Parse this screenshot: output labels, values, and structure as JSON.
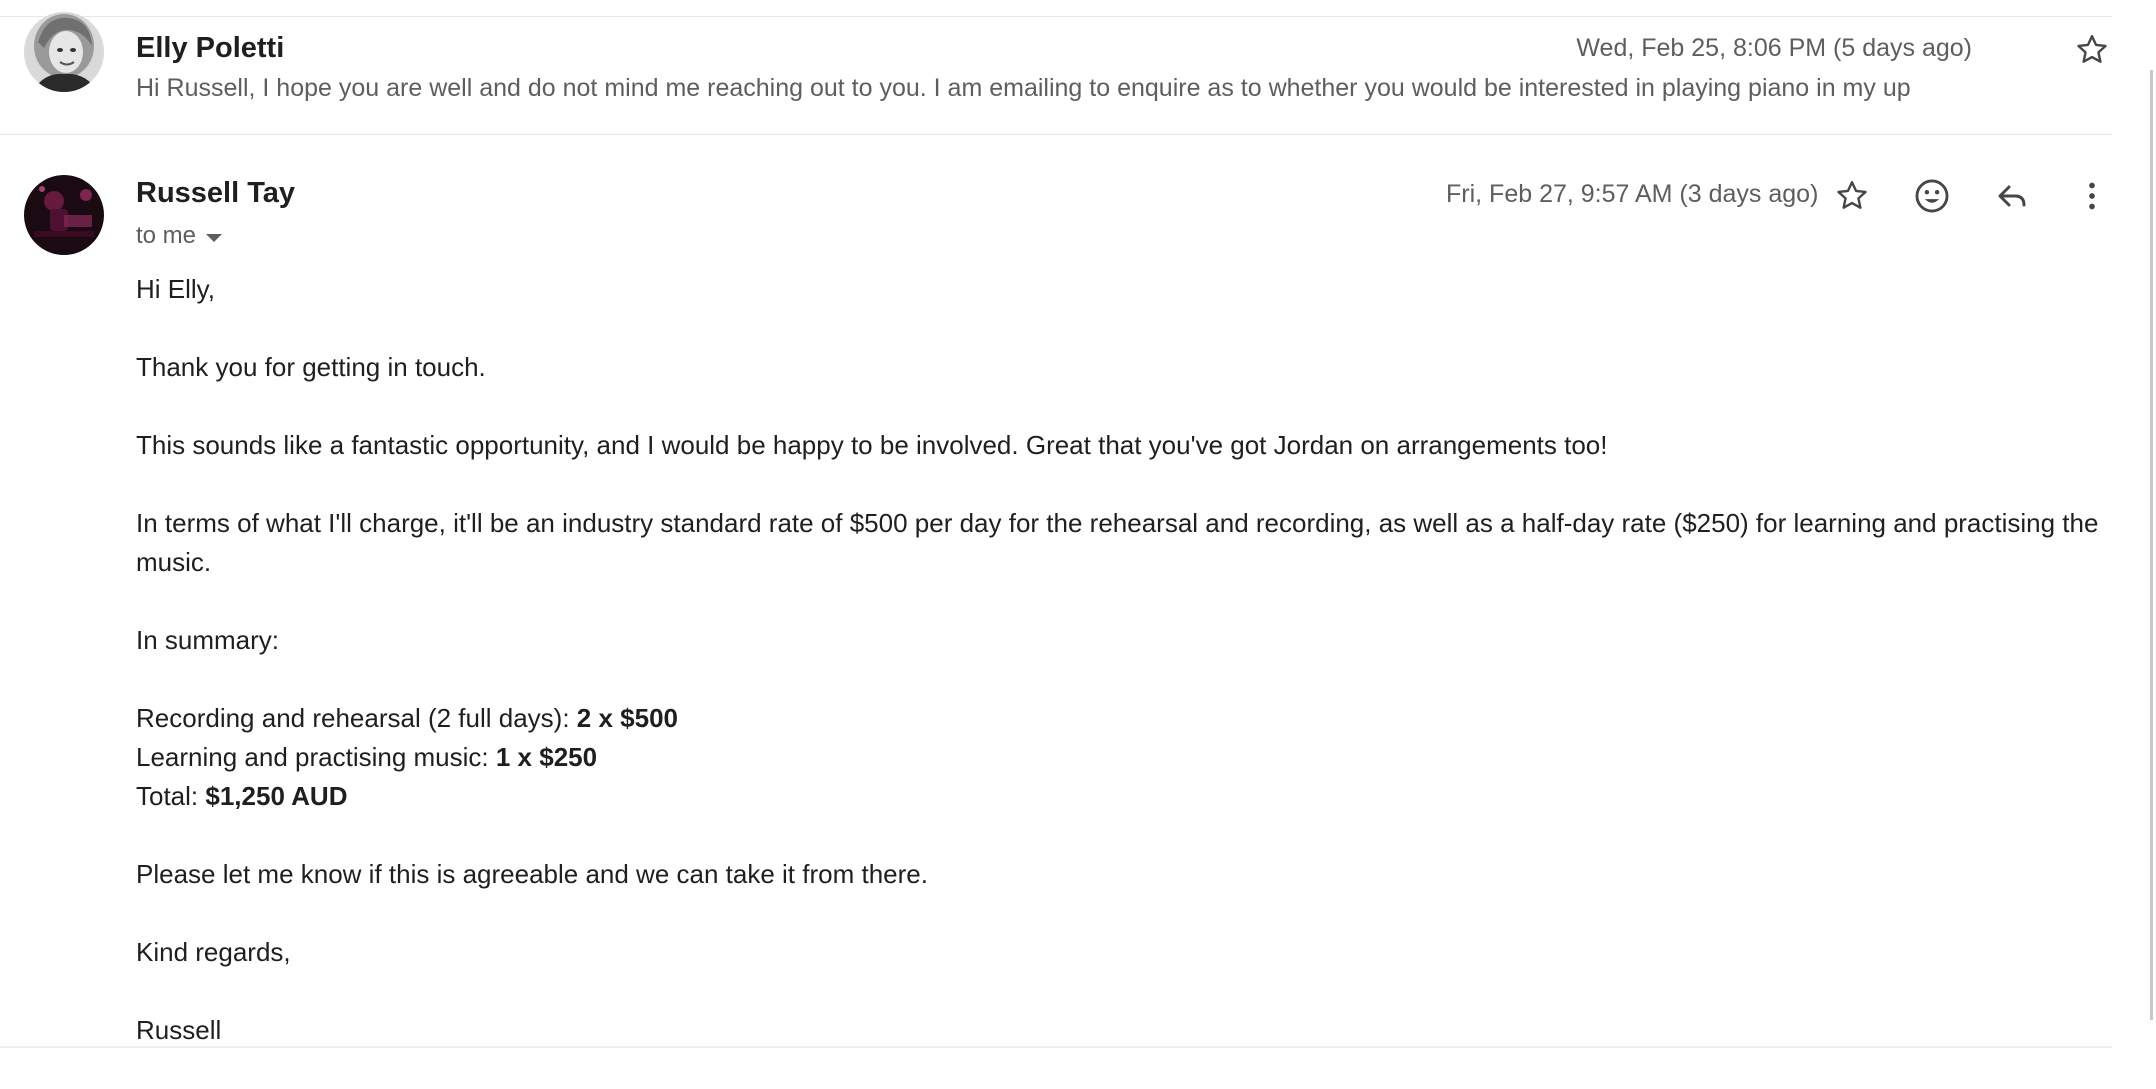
{
  "collapsed_message": {
    "sender": "Elly Poletti",
    "date": "Wed, Feb 25, 8:06 PM (5 days ago)",
    "snippet": "Hi Russell, I hope you are well and do not mind me reaching out to you. I am emailing to enquire as to whether you would be interested in playing piano in my up",
    "star_icon": "star-outline-icon"
  },
  "open_message": {
    "sender": "Russell Tay",
    "recipient": "to me",
    "date": "Fri, Feb 27, 9:57 AM (3 days ago)",
    "icons": [
      "star-outline-icon",
      "emoji-icon",
      "reply-icon",
      "more-vert-icon"
    ],
    "body": {
      "greeting": "Hi Elly,",
      "p1": "Thank you for getting in touch.",
      "p2": "This sounds like a fantastic opportunity, and I would be happy to be involved. Great that you've got Jordan on arrangements too!",
      "p3": "In terms of what I'll charge, it'll be an industry standard rate of $500 per day for the rehearsal and recording, as well as a half-day rate ($250) for learning and practising the music.",
      "summary_heading": "In summary:",
      "line1_label": "Recording and rehearsal (2 full days): ",
      "line1_value": "2 x $500",
      "line2_label": "Learning and practising music: ",
      "line2_value": "1 x $250",
      "total_label": "Total: ",
      "total_value": "$1,250 AUD",
      "closing_request": "Please let me know if this is agreeable and we can take it from there.",
      "signoff": "Kind regards,",
      "signature": "Russell"
    }
  },
  "colors": {
    "primary_text": "#1f1f1f",
    "secondary_text": "#5e5e5e",
    "icon": "#444746",
    "divider": "#e4e4e4"
  }
}
